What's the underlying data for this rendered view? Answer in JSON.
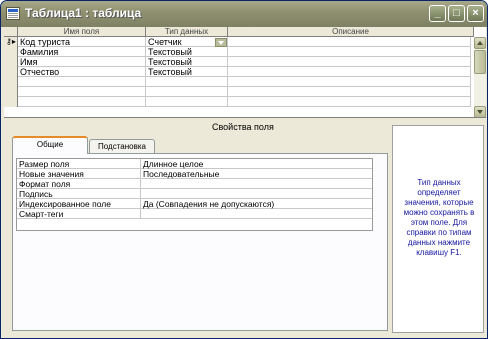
{
  "window": {
    "title": "Таблица1 : таблица"
  },
  "grid": {
    "headers": [
      "Имя поля",
      "Тип данных",
      "Описание"
    ],
    "rows": [
      {
        "name": "Код туриста",
        "type": "Счетчик",
        "desc": ""
      },
      {
        "name": "Фамилия",
        "type": "Текстовый",
        "desc": ""
      },
      {
        "name": "Имя",
        "type": "Текстовый",
        "desc": ""
      },
      {
        "name": "Отчество",
        "type": "Текстовый",
        "desc": ""
      },
      {
        "name": "",
        "type": "",
        "desc": ""
      },
      {
        "name": "",
        "type": "",
        "desc": ""
      },
      {
        "name": "",
        "type": "",
        "desc": ""
      }
    ]
  },
  "properties": {
    "title": "Свойства поля",
    "tabs": [
      "Общие",
      "Подстановка"
    ],
    "active_tab": "Общие",
    "rows": [
      {
        "label": "Размер поля",
        "value": "Длинное целое"
      },
      {
        "label": "Новые значения",
        "value": "Последовательные"
      },
      {
        "label": "Формат поля",
        "value": ""
      },
      {
        "label": "Подпись",
        "value": ""
      },
      {
        "label": "Индексированное поле",
        "value": "Да (Совпадения не допускаются)"
      },
      {
        "label": "Смарт-теги",
        "value": ""
      }
    ]
  },
  "help": {
    "text": "Тип данных определяет значения, которые можно сохранять в этом поле. Для справки по типам данных нажмите клавишу F1."
  },
  "colors": {
    "title_bar": "#8f9171",
    "help_text": "#1515a0",
    "active_tab_accent": "#e68b2c"
  }
}
